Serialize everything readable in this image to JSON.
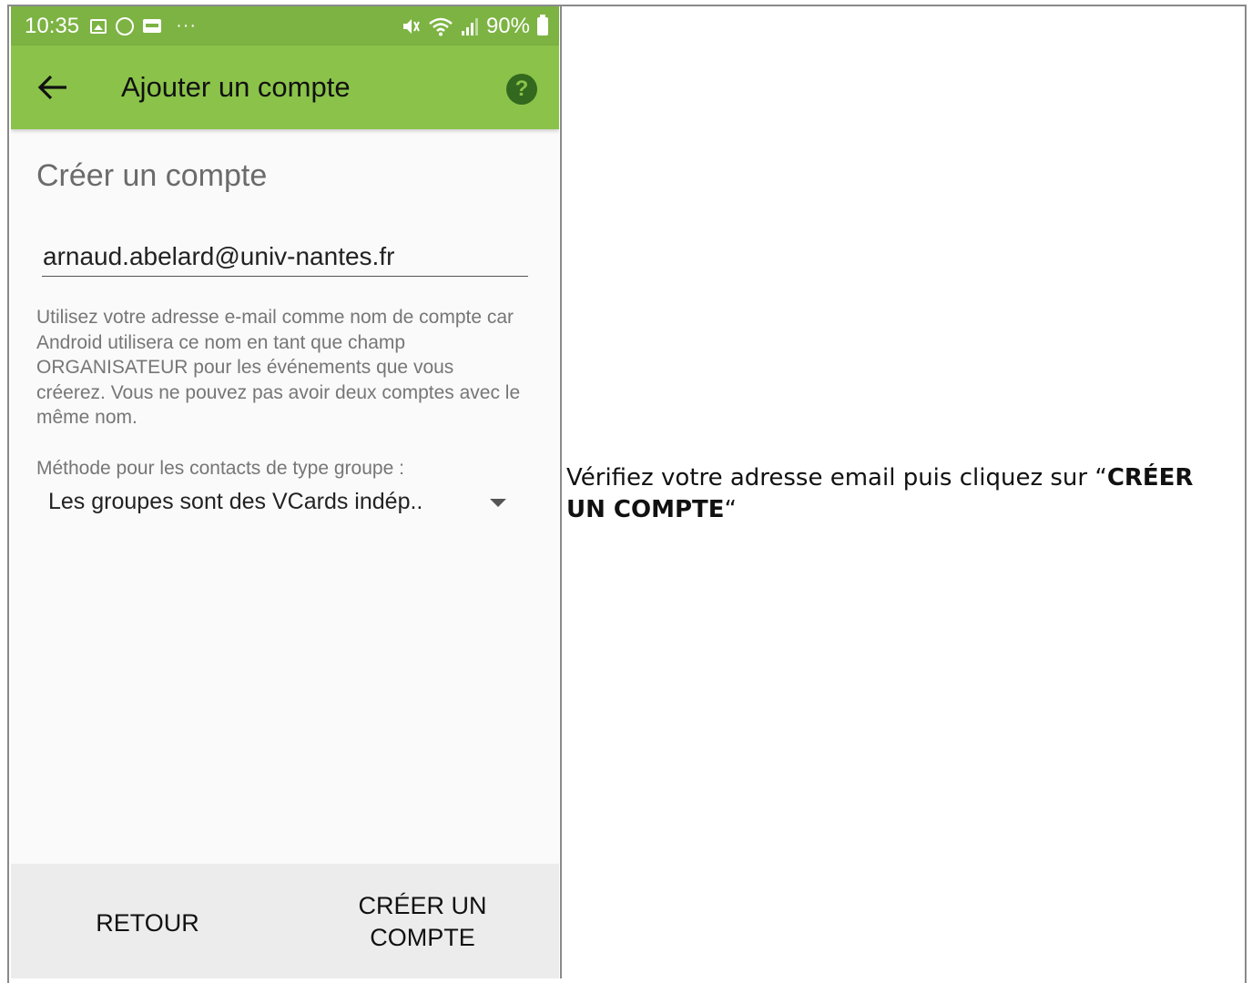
{
  "status_bar": {
    "time": "10:35",
    "left_icons": [
      "image-icon",
      "whatsapp-icon",
      "card-icon"
    ],
    "more": "···",
    "battery": "90%",
    "right_icons": [
      "mute-icon",
      "wifi-icon",
      "signal-icon",
      "battery-icon"
    ]
  },
  "app_bar": {
    "title": "Ajouter un compte",
    "help": "?",
    "color": "#8bc34a"
  },
  "form": {
    "section_title": "Créer un compte",
    "account_name_value": "arnaud.abelard@univ-nantes.fr",
    "help_text": "Utilisez votre adresse e-mail comme nom de compte car Android utilisera ce nom en tant que champ ORGANISATEUR pour les événements que vous créerez. Vous ne pouvez pas avoir deux comptes avec le même nom.",
    "group_method_label": "Méthode pour les contacts de type groupe :",
    "group_method_value": "Les groupes sont des VCards indép.."
  },
  "actions": {
    "back": "RETOUR",
    "create": "CRÉER UN COMPTE"
  },
  "instruction": {
    "prefix": "Vérifiez votre adresse email puis cliquez sur “",
    "bold": "CRÉER UN COMPTE",
    "suffix": "“"
  }
}
